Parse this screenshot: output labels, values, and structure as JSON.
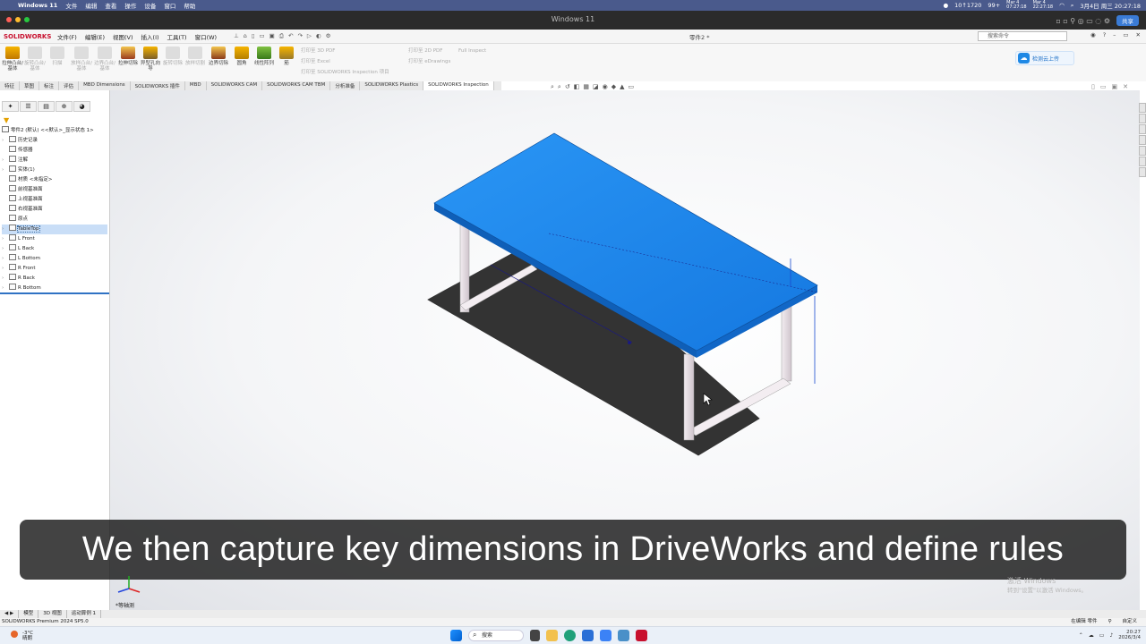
{
  "mac_menubar": {
    "app_name": "Windows 11",
    "items": [
      "文件",
      "编辑",
      "查看",
      "操作",
      "设备",
      "窗口",
      "帮助"
    ],
    "net_speed": "10↑1720",
    "badge": "99+",
    "clock1": "Mar 4\n07:27:18",
    "clock2": "Mar 4\n22:27:18",
    "datetime": "3月4日 周三  20:27:18"
  },
  "window": {
    "title": "Windows 11",
    "share_label": "共享"
  },
  "sw_menu": {
    "logo": "SOLIDWORKS",
    "items": [
      "文件(F)",
      "编辑(E)",
      "视图(V)",
      "插入(I)",
      "工具(T)",
      "窗口(W)"
    ],
    "doc_title": "零件2 *",
    "search_placeholder": "搜索命令"
  },
  "command_manager": {
    "tools": [
      {
        "label": "拉伸凸台/基体",
        "dim": false
      },
      {
        "label": "旋转凸台/基体",
        "dim": true
      },
      {
        "label": "扫描",
        "dim": true
      },
      {
        "label": "放样凸台/基体",
        "dim": true
      },
      {
        "label": "边界凸台/基体",
        "dim": true
      },
      {
        "label": "拉伸切除",
        "dim": false
      },
      {
        "label": "异型孔向导",
        "dim": false
      },
      {
        "label": "旋转切除",
        "dim": true
      },
      {
        "label": "放样切割",
        "dim": true
      },
      {
        "label": "边界切除",
        "dim": true
      },
      {
        "label": "圆角",
        "dim": false
      },
      {
        "label": "线性阵列",
        "dim": false
      },
      {
        "label": "筋",
        "dim": false
      },
      {
        "label": "拔模",
        "dim": false
      },
      {
        "label": "抽壳",
        "dim": false
      }
    ],
    "small_tools": [
      "打印至 3D PDF",
      "打印至 Excel",
      "打印至 SOLIDWORKS Inspection 项目"
    ],
    "small_tools2": [
      "打印至 2D PDF",
      "打印至 eDrawings"
    ],
    "small_tools3": [
      "Full Inspect"
    ],
    "cloud_label": "检测云上传"
  },
  "feature_tabs": [
    "特征",
    "草图",
    "标注",
    "评估",
    "MBD Dimensions",
    "SOLIDWORKS 插件",
    "MBD",
    "SOLIDWORKS CAM",
    "SOLIDWORKS CAM TBM",
    "分析准备",
    "SOLIDWORKS Plastics",
    "SOLIDWORKS Inspection"
  ],
  "active_tab_index": 11,
  "tree": {
    "root": "零件2 (默认) <<默认>_显示状态 1>",
    "items": [
      {
        "label": "历史记录",
        "arrow": true,
        "selected": false
      },
      {
        "label": "传感器",
        "arrow": false,
        "selected": false
      },
      {
        "label": "注解",
        "arrow": true,
        "selected": false
      },
      {
        "label": "实体(1)",
        "arrow": true,
        "selected": false
      },
      {
        "label": "材质 <未指定>",
        "arrow": false,
        "selected": false
      },
      {
        "label": "前视基准面",
        "arrow": false,
        "selected": false
      },
      {
        "label": "上视基准面",
        "arrow": false,
        "selected": false
      },
      {
        "label": "右视基准面",
        "arrow": false,
        "selected": false
      },
      {
        "label": "原点",
        "arrow": false,
        "selected": false
      },
      {
        "label": "TableTop",
        "arrow": true,
        "selected": true
      },
      {
        "label": "L Front",
        "arrow": true,
        "selected": false
      },
      {
        "label": "L Back",
        "arrow": true,
        "selected": false
      },
      {
        "label": "L Bottom",
        "arrow": true,
        "selected": false
      },
      {
        "label": "R Front",
        "arrow": true,
        "selected": false
      },
      {
        "label": "R Back",
        "arrow": true,
        "selected": false
      },
      {
        "label": "R Bottom",
        "arrow": true,
        "selected": false
      }
    ]
  },
  "viewport": {
    "triad_label": "*等轴测",
    "watermark_line1": "激活 Windows",
    "watermark_line2": "转到\"设置\"以激活 Windows。"
  },
  "subtitle": "We then capture key dimensions in DriveWorks and define rules",
  "doc_tabs": [
    "模型",
    "3D 视图",
    "运动算例 1"
  ],
  "status": {
    "left": "SOLIDWORKS Premium 2024 SP5.0",
    "right1": "在编辑 零件",
    "right2": "自定义"
  },
  "taskbar": {
    "weather_temp": "-3°C",
    "weather_desc": "晴朗",
    "search_label": "搜索",
    "time": "20:27",
    "date": "2026/3/4"
  },
  "colors": {
    "tabletop": "#1e8cf0",
    "legs": "#e9dfe6",
    "subtitle_bg": "#141414",
    "mac_bar": "#4a5a8c"
  }
}
